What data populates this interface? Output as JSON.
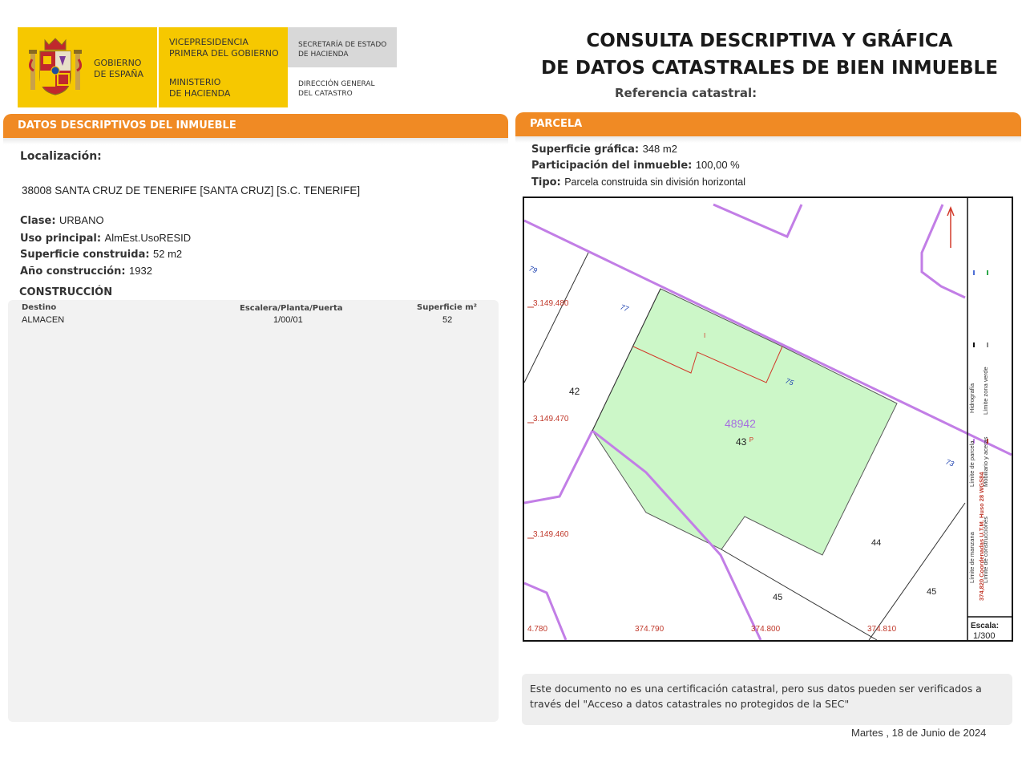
{
  "header": {
    "gobierno": [
      "GOBIERNO",
      "DE ESPAÑA"
    ],
    "vicepresidencia": [
      "VICEPRESIDENCIA",
      "PRIMERA DEL GOBIERNO"
    ],
    "ministerio": [
      "MINISTERIO",
      "DE HACIENDA"
    ],
    "secretaria": [
      "SECRETARÍA DE ESTADO",
      "DE HACIENDA"
    ],
    "direccion": [
      "DIRECCIÓN GENERAL",
      "DEL CATASTRO"
    ],
    "title_line1": "CONSULTA DESCRIPTIVA Y GRÁFICA",
    "title_line2": "DE DATOS CATASTRALES DE BIEN INMUEBLE",
    "ref_label": "Referencia catastral:",
    "colors": {
      "yellow": "#f6c800",
      "orange": "#f08a24",
      "gray": "#d8d8d8"
    }
  },
  "descriptivos": {
    "section_title": "DATOS DESCRIPTIVOS DEL INMUEBLE",
    "localizacion_label": "Localización:",
    "address": "38008 SANTA CRUZ DE TENERIFE [SANTA CRUZ] [S.C. TENERIFE]",
    "clase_label": "Clase:",
    "clase": "URBANO",
    "uso_label": "Uso principal:",
    "uso": "AlmEst.UsoRESID",
    "superficie_label": "Superficie construida:",
    "superficie": "52 m2",
    "anio_label": "Año construcción:",
    "anio": "1932",
    "construccion_title": "CONSTRUCCIÓN",
    "table_headers": [
      "Destino",
      "Escalera/Planta/Puerta",
      "Superficie m²"
    ],
    "table_rows": [
      [
        "ALMACEN",
        "1/00/01",
        "52"
      ]
    ]
  },
  "parcela": {
    "section_title": "PARCELA",
    "superficie_label": "Superficie gráfica:",
    "superficie": "348 m2",
    "participacion_label": "Participación del inmueble:",
    "participacion": "100,00 %",
    "tipo_label": "Tipo:",
    "tipo": "Parcela construida sin división horizontal"
  },
  "map": {
    "parcel_id": "48942",
    "parcel_number": "43",
    "parcel_suffix": "P",
    "small_mark": "I",
    "neighbor_labels": [
      "42",
      "44",
      "45",
      "45"
    ],
    "street_numbers": [
      "79",
      "77",
      "75",
      "73"
    ],
    "y_coords": [
      "3.149.480",
      "3.149.470",
      "3.149.460"
    ],
    "x_coords": [
      "4.780",
      "374.790",
      "374.800",
      "374.810"
    ],
    "legend": [
      "Hidrografía",
      "Límite zona verde",
      "Límite de parcela",
      "Mobiliario y aceras",
      "Límite de manzana",
      "Límite de construcciones"
    ],
    "coord_system": "374,820 Coordenadas U.T.M. Huso 28 WGS84",
    "escala_label": "Escala:",
    "escala": "1/300",
    "colors": {
      "parcel_fill": "#ccf7c8",
      "manzana": "#c27ee6",
      "coord": "#c0392b",
      "street": "#1a3fb0"
    }
  },
  "footer": {
    "note": [
      "Este documento no es una certificación catastral, pero sus datos pueden ser verificados a",
      "través del \"Acceso a datos catastrales no protegidos de la SEC\""
    ],
    "date": "Martes , 18 de Junio de 2024"
  }
}
